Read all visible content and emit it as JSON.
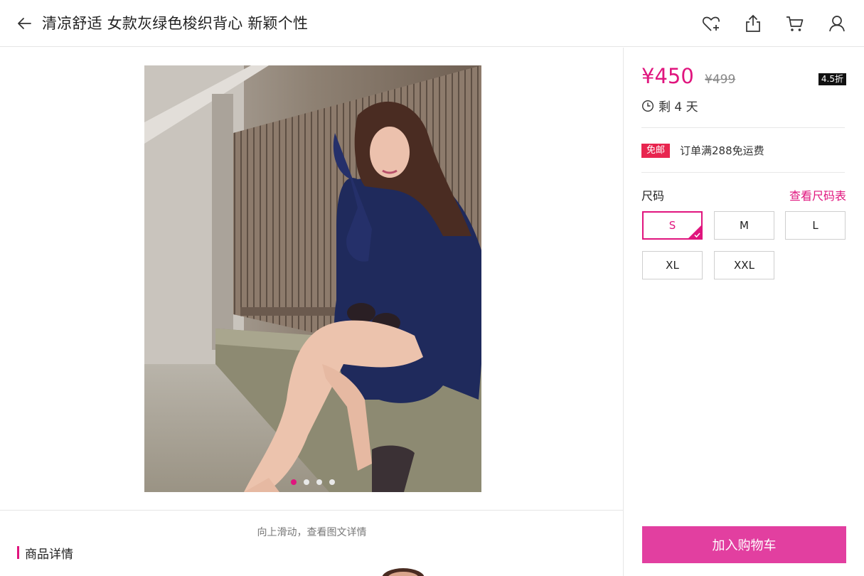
{
  "header": {
    "title": "清凉舒适 女款灰绿色梭织背心 新颖个性",
    "icons": [
      "back-arrow-icon",
      "heart-add-icon",
      "share-icon",
      "cart-icon",
      "user-icon"
    ]
  },
  "gallery": {
    "image_count": 4,
    "active_index": 0
  },
  "details": {
    "scroll_hint": "向上滑动，查看图文详情",
    "section_title": "商品详情"
  },
  "product": {
    "price": "¥450",
    "original_price": "¥499",
    "discount": "4.5折",
    "countdown": "剩 4 天",
    "shipping_badge": "免邮",
    "shipping_text": "订单满288免运费",
    "size_label": "尺码",
    "size_chart_link": "查看尺码表",
    "sizes": [
      "S",
      "M",
      "L",
      "XL",
      "XXL"
    ],
    "selected_size": "S",
    "add_to_cart": "加入购物车"
  },
  "colors": {
    "accent": "#e0157e",
    "cart_button": "#e23fa0",
    "badge": "#e8254f"
  }
}
